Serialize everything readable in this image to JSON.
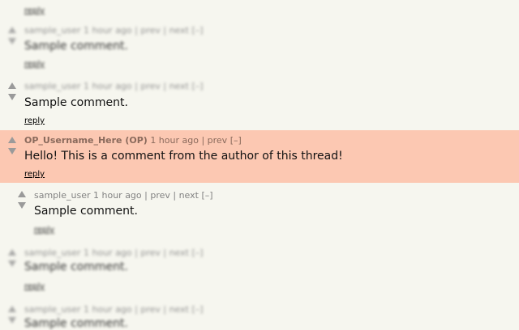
{
  "comments": [
    {
      "user": "sample_user",
      "age": "1 hour ago",
      "nav": "| prev | next [–]",
      "text": "Sample comment.",
      "reply": "reply"
    },
    {
      "user": "sample_user",
      "age": "1 hour ago",
      "nav": "| prev | next [–]",
      "text": "Sample comment.",
      "reply": "reply"
    },
    {
      "user": "OP_Username_Here (OP)",
      "age": "1 hour ago",
      "nav": "| prev [–]",
      "text": "Hello! This is a comment from the author of this thread!",
      "reply": "reply"
    },
    {
      "user": "sample_user",
      "age": "1 hour ago",
      "nav": "| prev | next [–]",
      "text": "Sample comment.",
      "reply": "reply"
    },
    {
      "user": "sample_user",
      "age": "1 hour ago",
      "nav": "| prev | next [–]",
      "text": "Sample comment.",
      "reply": "reply"
    },
    {
      "user": "sample_user",
      "age": "1 hour ago",
      "nav": "| prev | next [–]",
      "text": "Sample comment.",
      "reply": ""
    }
  ],
  "top_reply": "reply",
  "colors": {
    "background": "#f6f6ef",
    "op_highlight": "#fcc8b2",
    "meta_text": "#828282"
  }
}
